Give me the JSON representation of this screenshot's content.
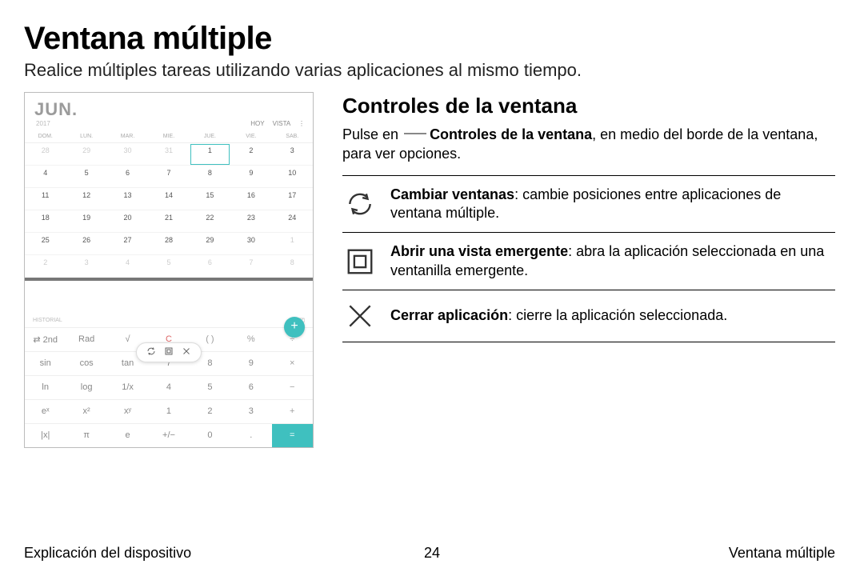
{
  "title": "Ventana múltiple",
  "subtitle": "Realice múltiples tareas utilizando varias aplicaciones al mismo tiempo.",
  "section_heading": "Controles de la ventana",
  "intro_pre": "Pulse en ",
  "intro_bold": "Controles de la ventana",
  "intro_post": ", en medio del borde de la ventana, para ver opciones.",
  "items": [
    {
      "bold": "Cambiar ventanas",
      "rest": ": cambie posiciones entre aplicaciones de ventana múltiple."
    },
    {
      "bold": "Abrir una vista emergente",
      "rest": ": abra la aplicación seleccionada en una ventanilla emergente."
    },
    {
      "bold": "Cerrar aplicación",
      "rest": ": cierre la aplicación seleccionada."
    }
  ],
  "footer": {
    "left": "Explicación del dispositivo",
    "page": "24",
    "right": "Ventana múltiple"
  },
  "screenshot": {
    "calendar": {
      "month": "JUN.",
      "year": "2017",
      "links": [
        "HOY",
        "VISTA"
      ],
      "weekdays": [
        "DOM.",
        "LUN.",
        "MAR.",
        "MIE.",
        "JUE.",
        "VIE.",
        "SAB."
      ],
      "weeks": [
        [
          "28",
          "29",
          "30",
          "31",
          "1",
          "2",
          "3"
        ],
        [
          "4",
          "5",
          "6",
          "7",
          "8",
          "9",
          "10"
        ],
        [
          "11",
          "12",
          "13",
          "14",
          "15",
          "16",
          "17"
        ],
        [
          "18",
          "19",
          "20",
          "21",
          "22",
          "23",
          "24"
        ],
        [
          "25",
          "26",
          "27",
          "28",
          "29",
          "30",
          "1"
        ],
        [
          "2",
          "3",
          "4",
          "5",
          "6",
          "7",
          "8"
        ]
      ],
      "selected_day": "1",
      "fab": "+"
    },
    "calculator": {
      "historial": "HISTORIAL",
      "rows": [
        [
          "⇄ 2nd",
          "Rad",
          "√",
          "C",
          "( )",
          "%",
          "÷"
        ],
        [
          "sin",
          "cos",
          "tan",
          "7",
          "8",
          "9",
          "×"
        ],
        [
          "ln",
          "log",
          "1/x",
          "4",
          "5",
          "6",
          "−"
        ],
        [
          "eˣ",
          "x²",
          "xʸ",
          "1",
          "2",
          "3",
          "+"
        ],
        [
          "|x|",
          "π",
          "e",
          "+/−",
          "0",
          ".",
          "="
        ]
      ]
    }
  }
}
